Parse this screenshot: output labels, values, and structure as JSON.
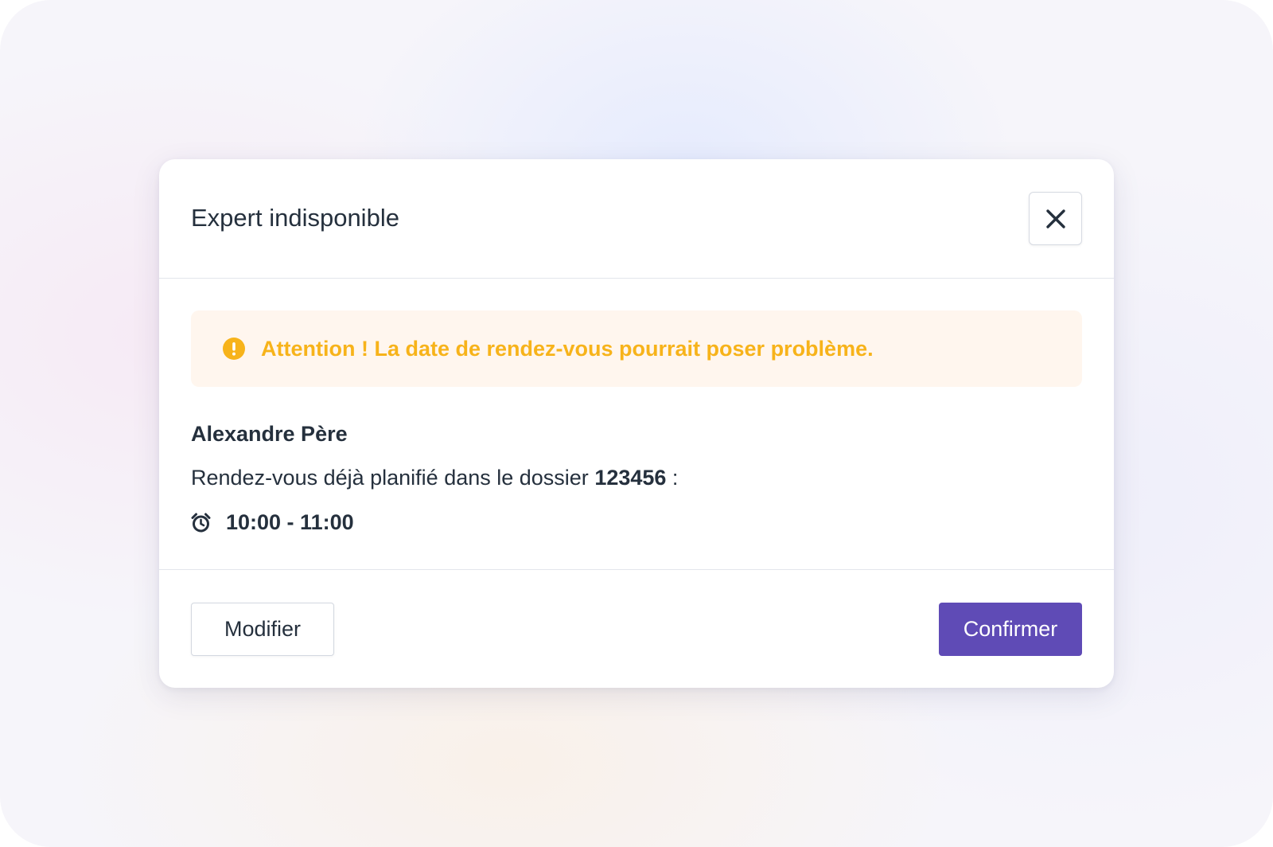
{
  "modal": {
    "title": "Expert indisponible",
    "close_icon": "close-icon"
  },
  "alert": {
    "icon": "exclamation-circle-icon",
    "text": "Attention ! La date de rendez-vous pourrait poser problème.",
    "color": "#f7b31a",
    "background": "#fff6ee"
  },
  "expert": {
    "name": "Alexandre Père"
  },
  "appointment": {
    "prefix": "Rendez-vous déjà planifié dans le dossier ",
    "dossier_number": "123456",
    "suffix": " :",
    "time_icon": "alarm-clock-icon",
    "time_range": "10:00 - 11:00"
  },
  "footer": {
    "modify_label": "Modifier",
    "confirm_label": "Confirmer",
    "primary_color": "#5f4bb6"
  }
}
